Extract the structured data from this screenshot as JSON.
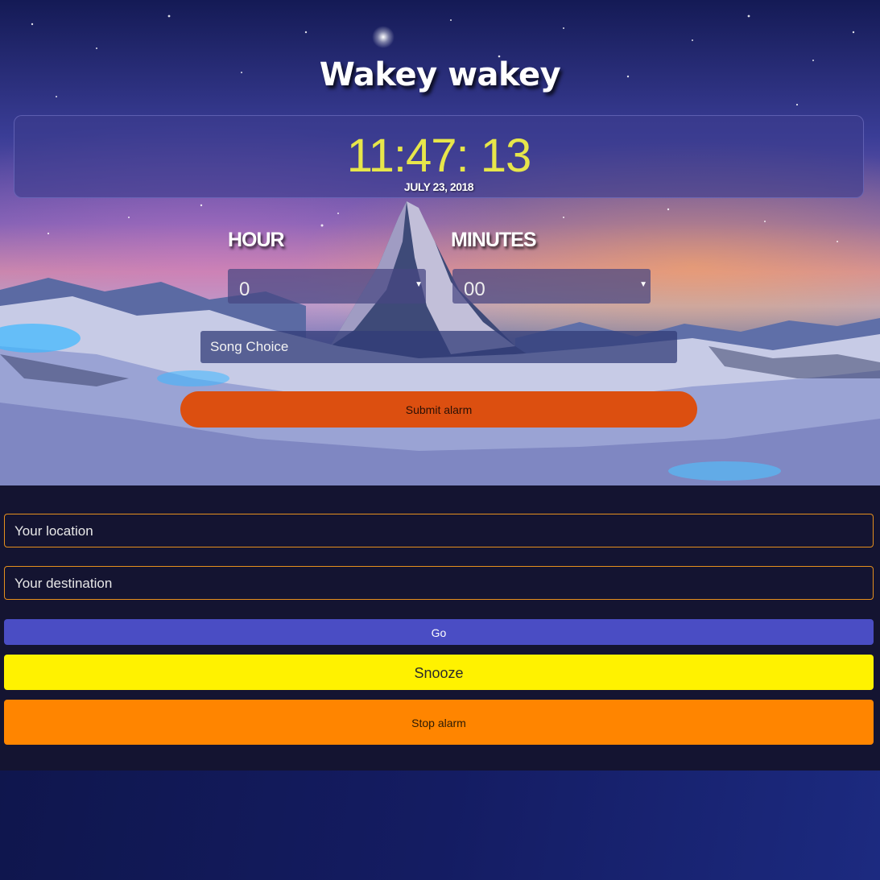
{
  "header": {
    "title": "Wakey wakey"
  },
  "clock": {
    "time": "11:47: 13",
    "date": "JULY 23, 2018"
  },
  "alarm_form": {
    "hour_label": "HOUR",
    "minutes_label": "MINUTES",
    "hour_value": "0",
    "minutes_value": "00",
    "song_placeholder": "Song Choice",
    "submit_label": "Submit alarm"
  },
  "travel": {
    "location_placeholder": "Your location",
    "destination_placeholder": "Your destination",
    "go_label": "Go"
  },
  "controls": {
    "snooze_label": "Snooze",
    "stop_label": "Stop alarm"
  },
  "icons": {
    "dropdown": "chevron-down-icon"
  },
  "colors": {
    "clock_text": "#e7e64a",
    "submit_button": "#dc4f10",
    "input_border": "#e58f1d",
    "go_button": "#4a4dc4",
    "snooze_button": "#fff200",
    "stop_button": "#ff8500",
    "panel_background": "#141431"
  }
}
